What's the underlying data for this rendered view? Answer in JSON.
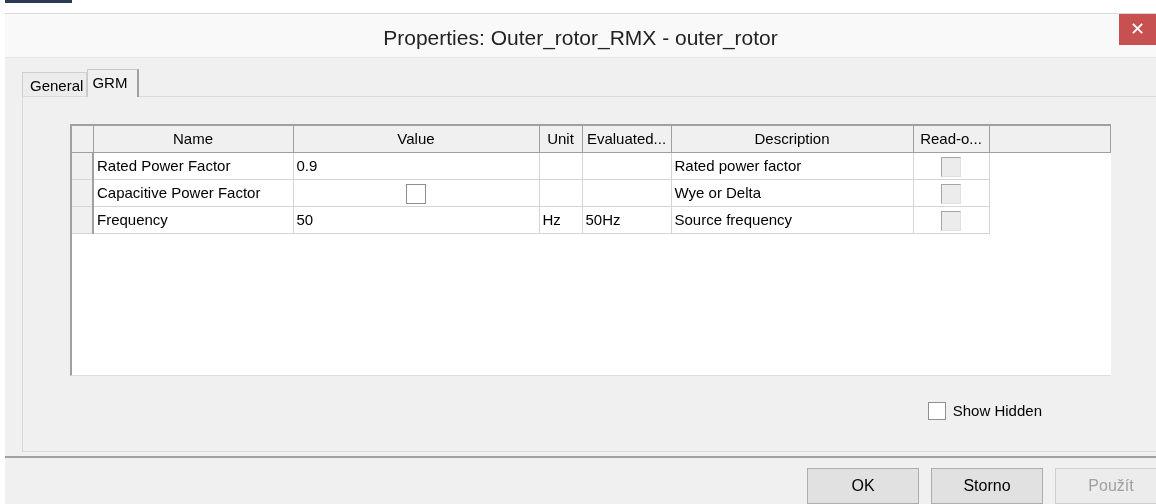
{
  "window": {
    "title": "Properties: Outer_rotor_RMX - outer_rotor",
    "close": "✕"
  },
  "tabs": [
    {
      "label": "General",
      "selected": false
    },
    {
      "label": "GRM",
      "selected": true
    }
  ],
  "grid": {
    "columns": [
      "Name",
      "Value",
      "Unit",
      "Evaluated...",
      "Description",
      "Read-o..."
    ],
    "rows": [
      {
        "name": "Rated Power Factor",
        "value": {
          "kind": "text",
          "text": "0.9"
        },
        "unit": "",
        "evaluated": "",
        "description": "Rated power factor",
        "read_only": {
          "checked": false,
          "disabled": true
        }
      },
      {
        "name": "Capacitive Power Factor",
        "value": {
          "kind": "checkbox",
          "checked": false
        },
        "unit": "",
        "evaluated": "",
        "description": "Wye or Delta",
        "read_only": {
          "checked": false,
          "disabled": true
        }
      },
      {
        "name": "Frequency",
        "value": {
          "kind": "text",
          "text": "50"
        },
        "unit": "Hz",
        "evaluated": "50Hz",
        "description": "Source frequency",
        "read_only": {
          "checked": false,
          "disabled": true
        }
      }
    ]
  },
  "show_hidden": {
    "label": "Show Hidden",
    "checked": false
  },
  "buttons": [
    {
      "label": "OK",
      "disabled": false
    },
    {
      "label": "Storno",
      "disabled": false
    },
    {
      "label": "Použít",
      "disabled": true
    }
  ]
}
